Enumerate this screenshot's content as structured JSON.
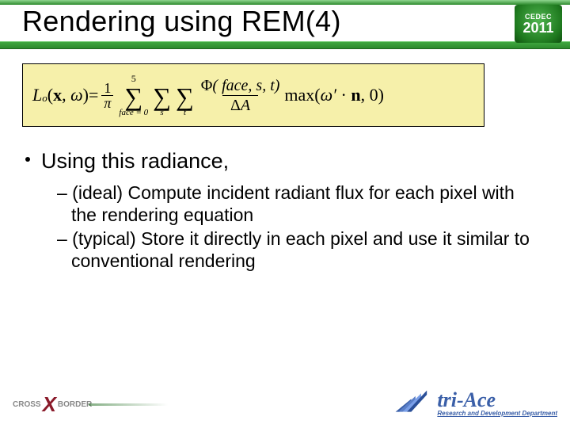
{
  "header": {
    "title": "Rendering using REM(4)",
    "event": "CEDEC",
    "year": "2011"
  },
  "formula": {
    "lhs_L": "L",
    "lhs_sub": "o",
    "lhs_args": "(x, ω)",
    "eq": " = ",
    "frac_one_pi_n": "1",
    "frac_one_pi_d": "π",
    "sum1_top": "5",
    "sum1_bottom": "face = 0",
    "sum2_bottom": "s",
    "sum3_bottom": "t",
    "phi_label": "Φ( face, s, t )",
    "deltaA": "ΔA",
    "max_expr": "max(ω′ · n, 0)"
  },
  "bullets": {
    "lvl1": "Using this radiance,",
    "sub1": "– (ideal) Compute incident radiant flux for each pixel with the rendering equation",
    "sub2": "– (typical) Store it directly in each pixel and use it similar to conventional rendering"
  },
  "footer": {
    "cross": "CROSS",
    "border": "BORDER",
    "tri_main": "tri-Ace",
    "tri_sub": "Research and Development Department"
  }
}
